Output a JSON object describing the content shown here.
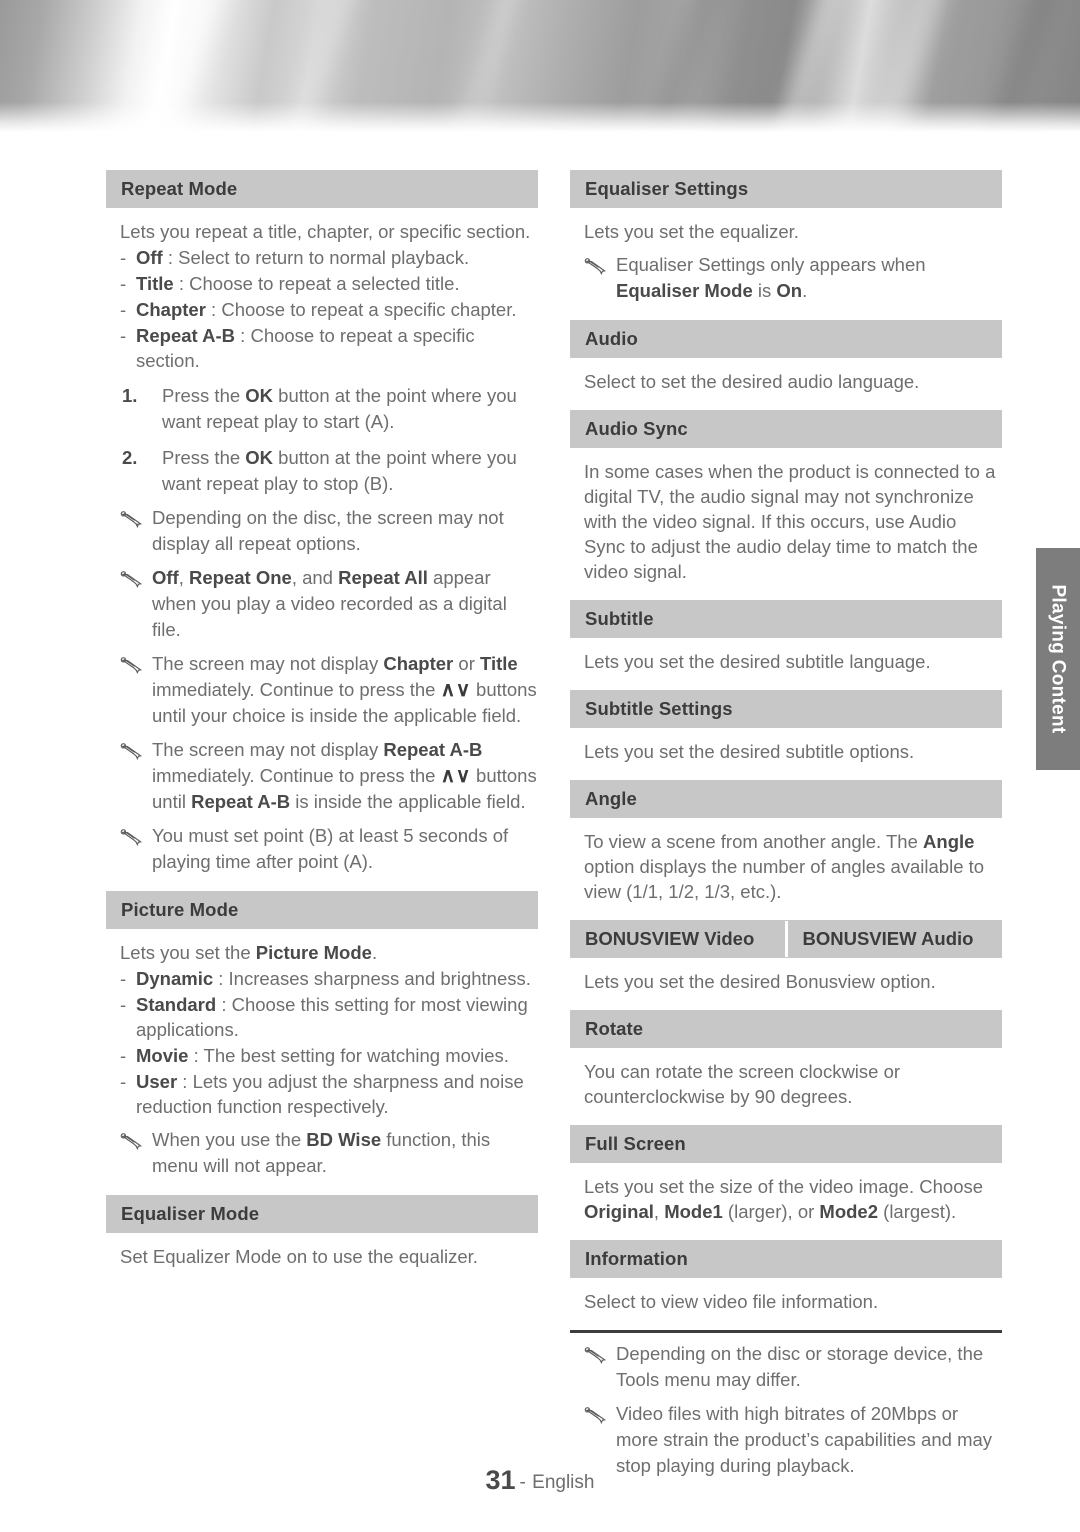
{
  "page": {
    "number": "31",
    "separator": "-",
    "language": "English",
    "side_tab": "Playing Content"
  },
  "left_column": {
    "sections": [
      {
        "heading": "Repeat Mode",
        "intro": "Lets you repeat a title, chapter, or specific section.",
        "dash_items": [
          {
            "marker": "-",
            "term": "Off",
            "sep": " : ",
            "text": "Select to return to normal playback."
          },
          {
            "marker": "-",
            "term": "Title",
            "sep": " : ",
            "text": "Choose to repeat a selected title."
          },
          {
            "marker": "-",
            "term": "Chapter",
            "sep": " : ",
            "text": "Choose to repeat a specific chapter."
          },
          {
            "marker": "-",
            "term": "Repeat A-B",
            "sep": " : ",
            "text": "Choose to repeat a specific section."
          }
        ],
        "numbered_items": [
          {
            "marker": "1.",
            "pre": "Press the ",
            "bold": "OK",
            "post": " button at the point where you want repeat play to start (A)."
          },
          {
            "marker": "2.",
            "pre": "Press the ",
            "bold": "OK",
            "post": " button at the point where you want repeat play to stop (B)."
          }
        ],
        "notes": [
          {
            "id": "note-repeat-options",
            "text": "Depending on the disc, the screen may not display all repeat options."
          },
          {
            "id": "note-off-repeat-one-all",
            "text": "Off, Repeat One, and Repeat All appear when you play a video recorded as a digital file."
          },
          {
            "id": "note-chapter-title",
            "text": "The screen may not display Chapter or Title immediately. Continue to press the ∧∨ buttons until your choice is inside the applicable field."
          },
          {
            "id": "note-repeat-ab",
            "text": "The screen may not display Repeat A-B immediately. Continue to press the ∧∨ buttons until Repeat A-B is inside the applicable field."
          },
          {
            "id": "note-point-b",
            "text": "You must set point (B) at least 5 seconds of playing time after point (A)."
          }
        ]
      },
      {
        "heading": "Picture Mode",
        "intro_pre": "Lets you set the ",
        "intro_bold": "Picture Mode",
        "intro_post": ".",
        "dash_items": [
          {
            "marker": "-",
            "term": "Dynamic",
            "sep": " : ",
            "text": "Increases sharpness and brightness."
          },
          {
            "marker": "-",
            "term": "Standard",
            "sep": " : ",
            "text": "Choose this setting for most viewing applications."
          },
          {
            "marker": "-",
            "term": "Movie",
            "sep": " : ",
            "text": "The best setting for watching movies."
          },
          {
            "marker": "-",
            "term": "User",
            "sep": " : ",
            "text": "Lets you adjust the sharpness and noise reduction function respectively."
          }
        ],
        "notes": [
          {
            "id": "note-bd-wise",
            "text": "When you use the BD Wise function, this menu will not appear."
          }
        ]
      },
      {
        "heading": "Equaliser Mode",
        "intro": "Set Equalizer Mode on to use the equalizer."
      }
    ]
  },
  "right_column": {
    "sections": [
      {
        "heading": "Equaliser Settings",
        "intro": "Lets you set the equalizer.",
        "notes": [
          {
            "id": "note-equaliser-settings",
            "text": "Equaliser Settings only appears when Equaliser Mode is On."
          }
        ]
      },
      {
        "heading": "Audio",
        "intro": "Select to set the desired audio language."
      },
      {
        "heading": "Audio Sync",
        "intro": "In some cases when the product is connected to a digital TV, the audio signal may not synchronize with the video signal. If this occurs, use Audio Sync to adjust the audio delay time to match the video signal."
      },
      {
        "heading": "Subtitle",
        "intro": "Lets you set the desired subtitle language."
      },
      {
        "heading": "Subtitle Settings",
        "intro": "Lets you set the desired subtitle options."
      },
      {
        "heading": "Angle",
        "intro_pre": "To view a scene from another angle. The ",
        "intro_bold": "Angle",
        "intro_post": " option displays the number of angles available to view (1/1, 1/2, 1/3, etc.)."
      },
      {
        "heading_left": "BONUSVIEW Video",
        "heading_right": "BONUSVIEW Audio",
        "intro": "Lets you set the desired Bonusview option."
      },
      {
        "heading": "Rotate",
        "intro": "You can rotate the screen clockwise or counterclockwise by 90 degrees."
      },
      {
        "heading": "Full Screen",
        "intro_line1": "Lets you set the size of the video image.",
        "intro_line2_pre": "Choose ",
        "intro_b1": "Original",
        "intro_mid1": ", ",
        "intro_b2": "Mode1",
        "intro_mid2": " (larger), or ",
        "intro_b3": "Mode2",
        "intro_mid3": " (largest)."
      },
      {
        "heading": "Information",
        "intro": "Select to view video file information."
      }
    ],
    "footer_notes": [
      {
        "id": "note-tools-menu",
        "text": "Depending on the disc or storage device, the Tools menu may differ."
      },
      {
        "id": "note-bitrate",
        "text": "Video files with high bitrates of 20Mbps or more strain the product’s capabilities and may stop playing during playback."
      }
    ]
  },
  "icons": {
    "note": "pencil-icon",
    "up_arrow": "∧",
    "down_arrow": "∨"
  },
  "colors": {
    "heading_bar": "#c7c7c7",
    "body_text": "#6e6e6e",
    "bold_text": "#4a4a4a",
    "side_tab": "#7d7d7d",
    "rule": "#3d3d3d"
  }
}
